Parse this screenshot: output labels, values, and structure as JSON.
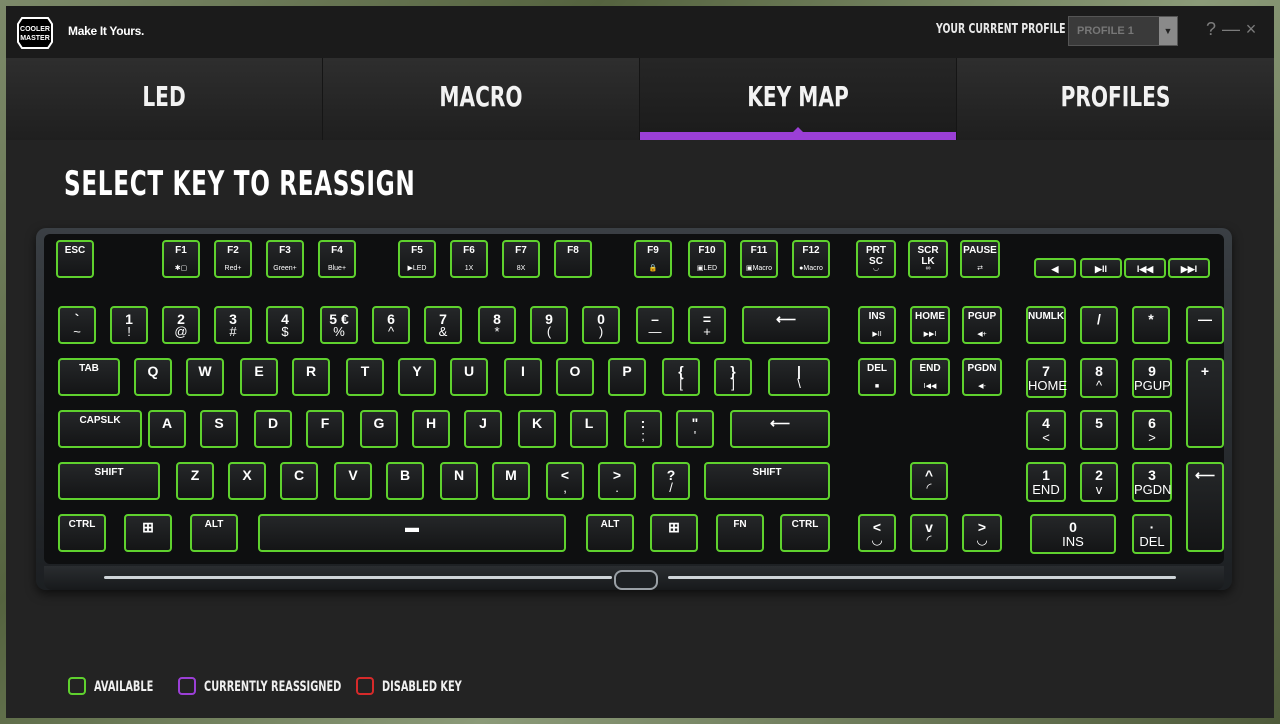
{
  "app": {
    "tagline": "Make It Yours.",
    "logo_text": "COOLER MASTER",
    "profile_label": "YOUR CURRENT PROFILE",
    "profile_value": "PROFILE 1",
    "help": "?",
    "minimize": "—",
    "close": "×"
  },
  "tabs": [
    {
      "label": "LED"
    },
    {
      "label": "MACRO"
    },
    {
      "label": "KEY MAP"
    },
    {
      "label": "PROFILES"
    }
  ],
  "active_tab": "KEY MAP",
  "heading": "SELECT KEY TO REASSIGN",
  "legend": [
    {
      "label": "AVAILABLE",
      "color": "#5fd12e"
    },
    {
      "label": "CURRENTLY REASSIGNED",
      "color": "#9b3fd6"
    },
    {
      "label": "DISABLED KEY",
      "color": "#d62a2a"
    }
  ],
  "keys": {
    "esc": {
      "t": "ESC",
      "b": ""
    },
    "f1": {
      "t": "F1",
      "b": "✱▢"
    },
    "f2": {
      "t": "F2",
      "b": "Red+"
    },
    "f3": {
      "t": "F3",
      "b": "Green+"
    },
    "f4": {
      "t": "F4",
      "b": "Blue+"
    },
    "f5": {
      "t": "F5",
      "b": "▶LED"
    },
    "f6": {
      "t": "F6",
      "b": "1X"
    },
    "f7": {
      "t": "F7",
      "b": "8X"
    },
    "f8": {
      "t": "F8",
      "b": ""
    },
    "f9": {
      "t": "F9",
      "b": "🔒"
    },
    "f10": {
      "t": "F10",
      "b": "▣LED"
    },
    "f11": {
      "t": "F11",
      "b": "▣Macro"
    },
    "f12": {
      "t": "F12",
      "b": "●Macro"
    },
    "prtsc": {
      "t": "PRT\nSC",
      "b": "◡"
    },
    "scrlk": {
      "t": "SCR\nLK",
      "b": "∞"
    },
    "pause": {
      "t": "PAUSE",
      "b": "⇄"
    },
    "mute": {
      "t": "◀",
      "b": ""
    },
    "play": {
      "t": "▶II",
      "b": ""
    },
    "prev": {
      "t": "I◀◀",
      "b": ""
    },
    "next": {
      "t": "▶▶I",
      "b": ""
    },
    "grave": {
      "t": "`",
      "b": "~"
    },
    "k1": {
      "t": "1",
      "b": "!"
    },
    "k2": {
      "t": "2",
      "b": "@"
    },
    "k3": {
      "t": "3",
      "b": "#"
    },
    "k4": {
      "t": "4",
      "b": "$"
    },
    "k5": {
      "t": "5 €",
      "b": "%"
    },
    "k6": {
      "t": "6",
      "b": "^"
    },
    "k7": {
      "t": "7",
      "b": "&"
    },
    "k8": {
      "t": "8",
      "b": "*"
    },
    "k9": {
      "t": "9",
      "b": "("
    },
    "k0": {
      "t": "0",
      "b": ")"
    },
    "minus": {
      "t": "–",
      "b": "—"
    },
    "equal": {
      "t": "=",
      "b": "+"
    },
    "backspace": {
      "t": "⟵",
      "b": ""
    },
    "ins": {
      "t": "INS",
      "b": "▶II"
    },
    "home": {
      "t": "HOME",
      "b": "▶▶I"
    },
    "pgup": {
      "t": "PGUP",
      "b": "◀+"
    },
    "numlk": {
      "t": "NUMLK",
      "b": ""
    },
    "ndiv": {
      "t": "/",
      "b": ""
    },
    "nmul": {
      "t": "*",
      "b": ""
    },
    "nminus": {
      "t": "—",
      "b": ""
    },
    "tab": {
      "t": "TAB",
      "b": ""
    },
    "q": {
      "t": "Q",
      "b": ""
    },
    "w": {
      "t": "W",
      "b": ""
    },
    "e": {
      "t": "E",
      "b": ""
    },
    "r": {
      "t": "R",
      "b": ""
    },
    "tt": {
      "t": "T",
      "b": ""
    },
    "y": {
      "t": "Y",
      "b": ""
    },
    "u": {
      "t": "U",
      "b": ""
    },
    "i": {
      "t": "I",
      "b": ""
    },
    "o": {
      "t": "O",
      "b": ""
    },
    "p": {
      "t": "P",
      "b": ""
    },
    "lbr": {
      "t": "{",
      "b": "["
    },
    "rbr": {
      "t": "}",
      "b": "]"
    },
    "bslash": {
      "t": "|",
      "b": "\\"
    },
    "del": {
      "t": "DEL",
      "b": "■"
    },
    "end": {
      "t": "END",
      "b": "I◀◀"
    },
    "pgdn": {
      "t": "PGDN",
      "b": "◀-"
    },
    "n7": {
      "t": "7",
      "b": "HOME"
    },
    "n8": {
      "t": "8",
      "b": "^"
    },
    "n9": {
      "t": "9",
      "b": "PGUP"
    },
    "nplus": {
      "t": "+",
      "b": ""
    },
    "caps": {
      "t": "CAPSLK",
      "b": ""
    },
    "a": {
      "t": "A",
      "b": ""
    },
    "s": {
      "t": "S",
      "b": ""
    },
    "d": {
      "t": "D",
      "b": ""
    },
    "f": {
      "t": "F",
      "b": ""
    },
    "g": {
      "t": "G",
      "b": ""
    },
    "h": {
      "t": "H",
      "b": ""
    },
    "j": {
      "t": "J",
      "b": ""
    },
    "k": {
      "t": "K",
      "b": ""
    },
    "l": {
      "t": "L",
      "b": ""
    },
    "semi": {
      "t": ":",
      "b": ";"
    },
    "quote": {
      "t": "\"",
      "b": "'"
    },
    "enter": {
      "t": "⟵",
      "b": ""
    },
    "n4": {
      "t": "4",
      "b": "<"
    },
    "n5": {
      "t": "5",
      "b": ""
    },
    "n6": {
      "t": "6",
      "b": ">"
    },
    "lshift": {
      "t": "SHIFT",
      "b": ""
    },
    "z": {
      "t": "Z",
      "b": ""
    },
    "x": {
      "t": "X",
      "b": ""
    },
    "c": {
      "t": "C",
      "b": ""
    },
    "v": {
      "t": "V",
      "b": ""
    },
    "bb": {
      "t": "B",
      "b": ""
    },
    "n": {
      "t": "N",
      "b": ""
    },
    "m": {
      "t": "M",
      "b": ""
    },
    "comma": {
      "t": "<",
      "b": ","
    },
    "period": {
      "t": ">",
      "b": "."
    },
    "slash": {
      "t": "?",
      "b": "/"
    },
    "rshift": {
      "t": "SHIFT",
      "b": ""
    },
    "up": {
      "t": "^",
      "b": "◜"
    },
    "n1": {
      "t": "1",
      "b": "END"
    },
    "n2": {
      "t": "2",
      "b": "v"
    },
    "n3": {
      "t": "3",
      "b": "PGDN"
    },
    "nenter": {
      "t": "⟵",
      "b": ""
    },
    "lctrl": {
      "t": "CTRL",
      "b": ""
    },
    "lwin": {
      "t": "⊞",
      "b": ""
    },
    "lalt": {
      "t": "ALT",
      "b": ""
    },
    "space": {
      "t": "▬",
      "b": ""
    },
    "ralt": {
      "t": "ALT",
      "b": ""
    },
    "rwin": {
      "t": "⊞",
      "b": ""
    },
    "fn": {
      "t": "FN",
      "b": ""
    },
    "rctrl": {
      "t": "CTRL",
      "b": ""
    },
    "left": {
      "t": "<",
      "b": "◡"
    },
    "down": {
      "t": "v",
      "b": "◜"
    },
    "right": {
      "t": ">",
      "b": "◡"
    },
    "n0": {
      "t": "0",
      "b": "INS"
    },
    "ndot": {
      "t": "·",
      "b": "DEL"
    }
  }
}
